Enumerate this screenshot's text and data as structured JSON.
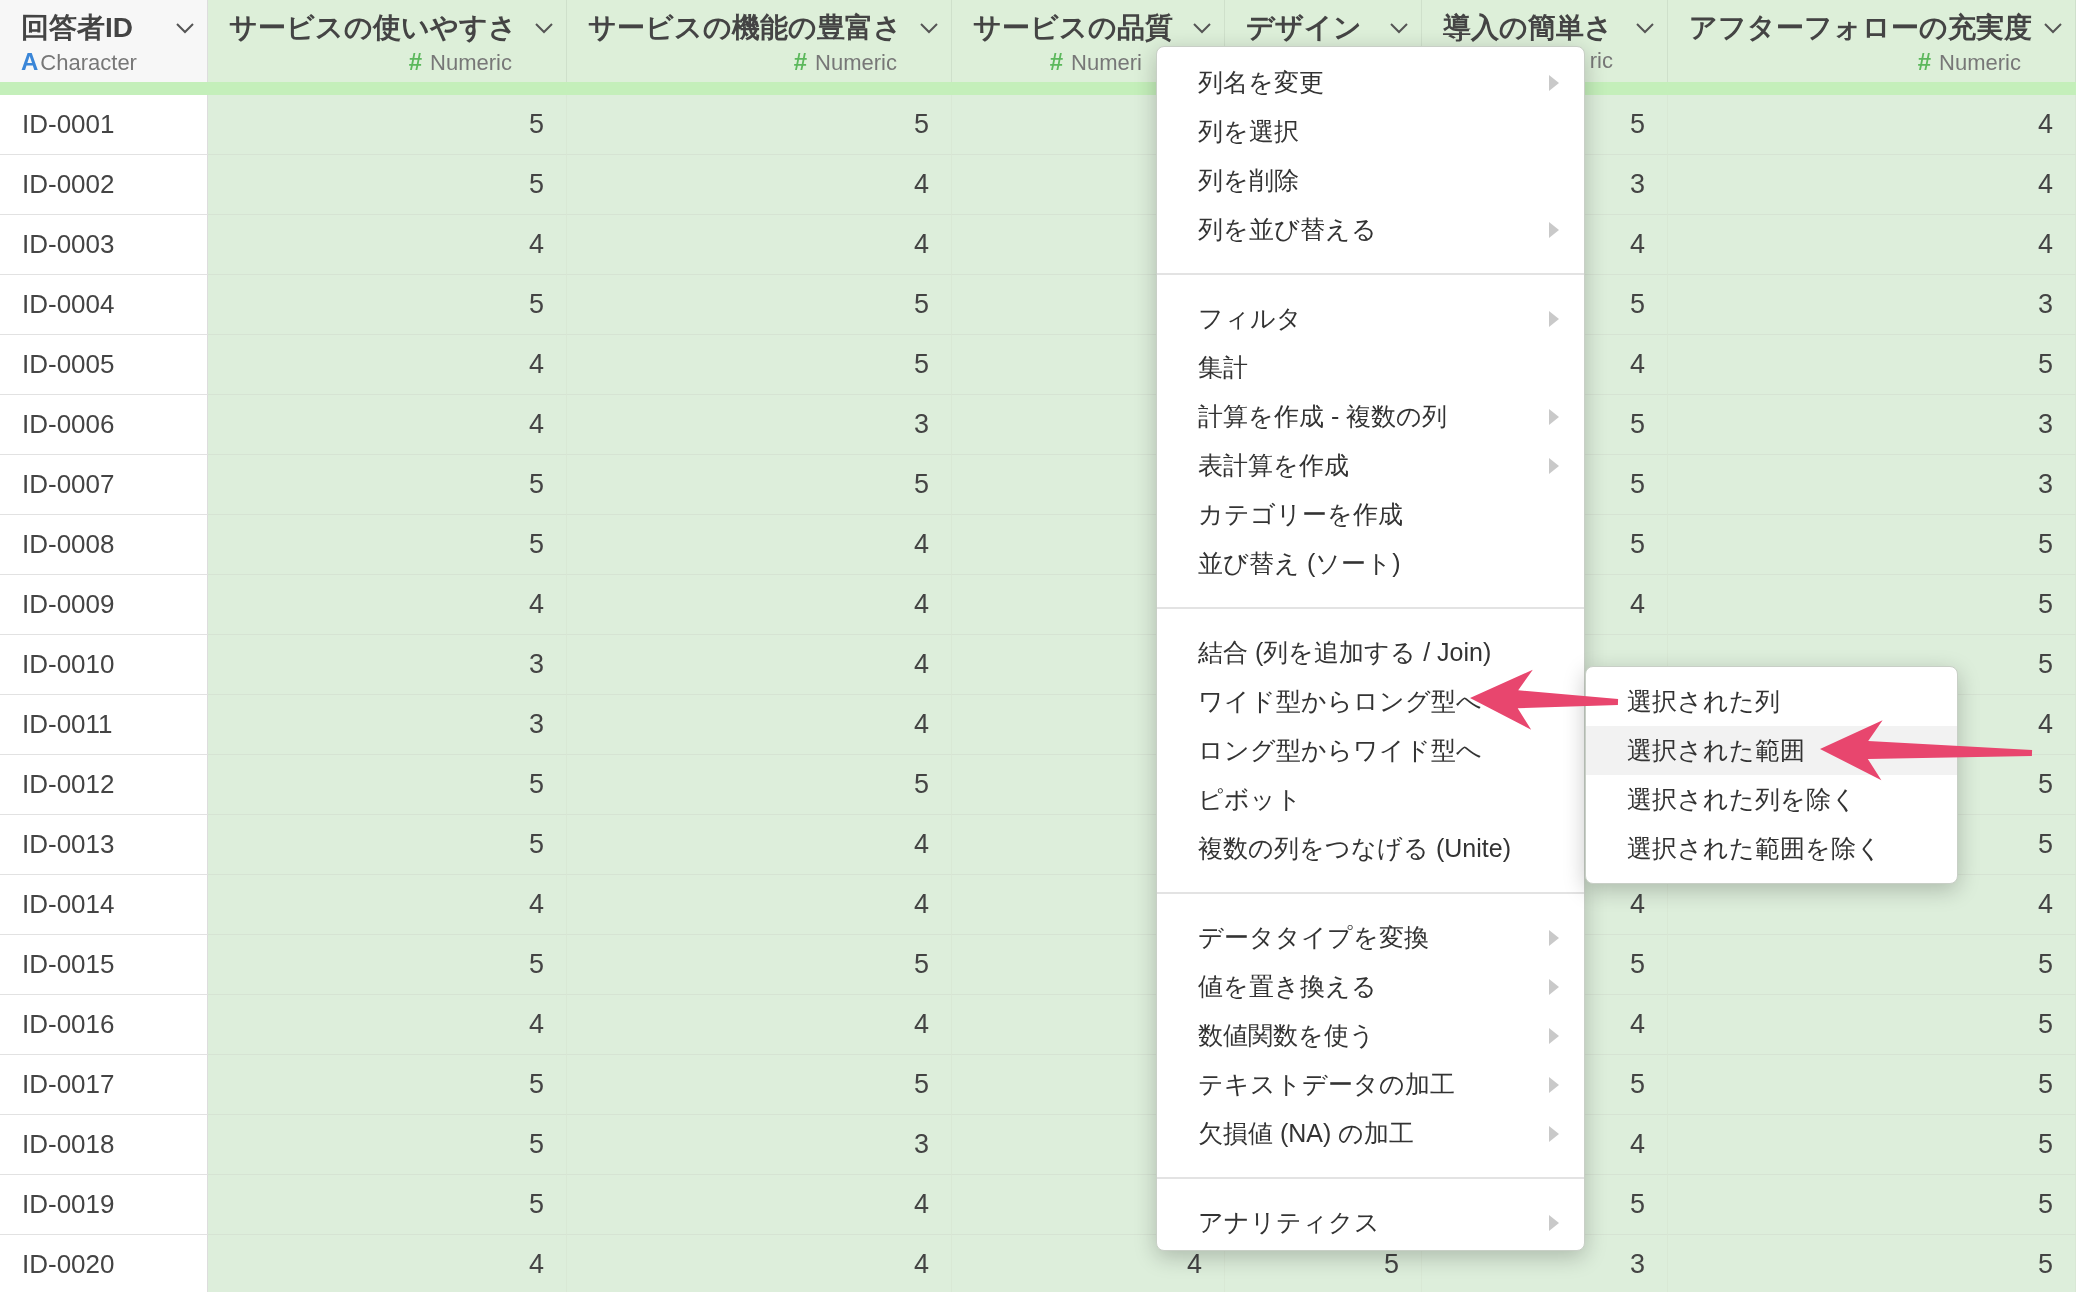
{
  "columns": [
    {
      "title": "回答者ID",
      "type_icon": "A",
      "color": "#3a86d8",
      "type_label": "Character"
    },
    {
      "title": "サービスの使いやすさ",
      "type_icon": "#",
      "color": "#5cb85c",
      "type_label": "Numeric"
    },
    {
      "title": "サービスの機能の豊富さ",
      "type_icon": "#",
      "color": "#5cb85c",
      "type_label": "Numeric"
    },
    {
      "title": "サービスの品質",
      "type_icon": "#",
      "color": "#5cb85c",
      "type_label": "Numeri"
    },
    {
      "title": "デザイン"
    },
    {
      "title": "導入の簡単さ",
      "type_label": "ric"
    },
    {
      "title": "アフターフォローの充実度",
      "type_icon": "#",
      "color": "#5cb85c",
      "type_label": "Numeric"
    }
  ],
  "rows": [
    {
      "id": "ID-0001",
      "cells": [
        "5",
        "5",
        null,
        null,
        "5",
        "4"
      ]
    },
    {
      "id": "ID-0002",
      "cells": [
        "5",
        "4",
        null,
        null,
        "3",
        "4"
      ]
    },
    {
      "id": "ID-0003",
      "cells": [
        "4",
        "4",
        null,
        null,
        "4",
        "4"
      ]
    },
    {
      "id": "ID-0004",
      "cells": [
        "5",
        "5",
        null,
        null,
        "5",
        "3"
      ]
    },
    {
      "id": "ID-0005",
      "cells": [
        "4",
        "5",
        null,
        null,
        "4",
        "5"
      ]
    },
    {
      "id": "ID-0006",
      "cells": [
        "4",
        "3",
        null,
        null,
        "5",
        "3"
      ]
    },
    {
      "id": "ID-0007",
      "cells": [
        "5",
        "5",
        null,
        null,
        "5",
        "3"
      ]
    },
    {
      "id": "ID-0008",
      "cells": [
        "5",
        "4",
        null,
        null,
        "5",
        "5"
      ]
    },
    {
      "id": "ID-0009",
      "cells": [
        "4",
        "4",
        null,
        null,
        "4",
        "5"
      ]
    },
    {
      "id": "ID-0010",
      "cells": [
        "3",
        "4",
        null,
        null,
        null,
        "5"
      ]
    },
    {
      "id": "ID-0011",
      "cells": [
        "3",
        "4",
        null,
        null,
        null,
        "4"
      ]
    },
    {
      "id": "ID-0012",
      "cells": [
        "5",
        "5",
        null,
        null,
        null,
        "5"
      ]
    },
    {
      "id": "ID-0013",
      "cells": [
        "5",
        "4",
        null,
        null,
        null,
        "5"
      ]
    },
    {
      "id": "ID-0014",
      "cells": [
        "4",
        "4",
        null,
        null,
        "4",
        "4"
      ]
    },
    {
      "id": "ID-0015",
      "cells": [
        "5",
        "5",
        null,
        null,
        "5",
        "5"
      ]
    },
    {
      "id": "ID-0016",
      "cells": [
        "4",
        "4",
        null,
        null,
        "4",
        "5"
      ]
    },
    {
      "id": "ID-0017",
      "cells": [
        "5",
        "5",
        null,
        null,
        "5",
        "5"
      ]
    },
    {
      "id": "ID-0018",
      "cells": [
        "5",
        "3",
        null,
        null,
        "4",
        "5"
      ]
    },
    {
      "id": "ID-0019",
      "cells": [
        "5",
        "4",
        null,
        null,
        "5",
        "5"
      ]
    },
    {
      "id": "ID-0020",
      "cells": [
        "4",
        "4",
        "4",
        "5",
        "3",
        "5"
      ]
    }
  ],
  "context_menu": {
    "groups": [
      [
        {
          "label": "列名を変更",
          "submenu": true
        },
        {
          "label": "列を選択",
          "submenu": false
        },
        {
          "label": "列を削除",
          "submenu": false
        },
        {
          "label": "列を並び替える",
          "submenu": true
        }
      ],
      [
        {
          "label": "フィルタ",
          "submenu": true
        },
        {
          "label": "集計",
          "submenu": false
        },
        {
          "label": "計算を作成 - 複数の列",
          "submenu": true
        },
        {
          "label": "表計算を作成",
          "submenu": true
        },
        {
          "label": "カテゴリーを作成",
          "submenu": false
        },
        {
          "label": "並び替え (ソート)",
          "submenu": false
        }
      ],
      [
        {
          "label": "結合 (列を追加する / Join)",
          "submenu": false
        },
        {
          "label": "ワイド型からロング型へ",
          "submenu": false
        },
        {
          "label": "ロング型からワイド型へ",
          "submenu": false
        },
        {
          "label": "ピボット",
          "submenu": false
        },
        {
          "label": "複数の列をつなげる (Unite)",
          "submenu": false
        }
      ],
      [
        {
          "label": "データタイプを変換",
          "submenu": true
        },
        {
          "label": "値を置き換える",
          "submenu": true
        },
        {
          "label": "数値関数を使う",
          "submenu": true
        },
        {
          "label": "テキストデータの加工",
          "submenu": true
        },
        {
          "label": "欠損値 (NA) の加工",
          "submenu": true
        }
      ],
      [
        {
          "label": "アナリティクス",
          "submenu": true
        }
      ]
    ]
  },
  "submenu": {
    "items": [
      {
        "label": "選択された列",
        "selected": false
      },
      {
        "label": "選択された範囲",
        "selected": true
      },
      {
        "label": "選択された列を除く",
        "selected": false
      },
      {
        "label": "選択された範囲を除く",
        "selected": false
      }
    ]
  }
}
